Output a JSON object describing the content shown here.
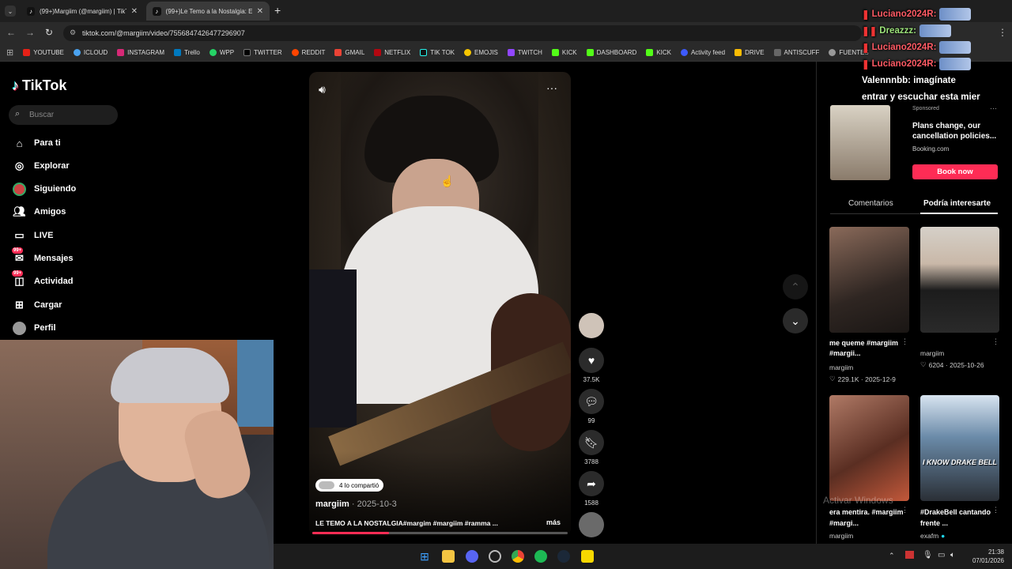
{
  "browser": {
    "tabs": [
      {
        "label": "(99+)Margiim (@margiim) | TikTok",
        "active": false
      },
      {
        "label": "(99+)Le Temo a la Nostalgia: Ex",
        "active": true
      }
    ],
    "new_tab": "+",
    "url": "tiktok.com/@margiim/video/7556847426477296907",
    "bookmarks": [
      "YOUTUBE",
      "ICLOUD",
      "INSTAGRAM",
      "Trello",
      "WPP",
      "TWITTER",
      "REDDIT",
      "GMAIL",
      "NETFLIX",
      "TIK TOK",
      "EMOJIS",
      "TWITCH",
      "KICK",
      "DASHBOARD",
      "KICK",
      "Activity feed",
      "DRIVE",
      "ANTISCUFF",
      "FUENTES"
    ]
  },
  "tiktok": {
    "logo": "TikTok",
    "search_placeholder": "Buscar",
    "nav": [
      "Para ti",
      "Explorar",
      "Siguiendo",
      "Amigos",
      "LIVE",
      "Mensajes",
      "Actividad",
      "Cargar",
      "Perfil"
    ],
    "badge": "99+"
  },
  "video": {
    "shared": "4 lo compartió",
    "author": "margiim",
    "date": "2025-10-3",
    "caption": "LE TEMO A LA NOSTALGIA#margim #margiim #ramma ...",
    "more": "más",
    "progress": 0.3
  },
  "actions": {
    "likes": "37.5K",
    "comments": "99",
    "saves": "3788",
    "shares": "1588"
  },
  "ad": {
    "sponsored": "Sponsored",
    "headline": "Plans change, our cancellation policies...",
    "advertiser": "Booking.com",
    "cta": "Book now"
  },
  "panel_tabs": [
    "Comentarios",
    "Podría interesarte"
  ],
  "suggestions": [
    {
      "title": "me queme #margiim #margii...",
      "author": "margiim",
      "stats": "229.1K · 2025-12-9"
    },
    {
      "title": "margiim",
      "author": "",
      "stats": "6204 · 2025-10-26"
    },
    {
      "title": "era mentira. #margiim #margi...",
      "author": "margiim",
      "stats": ""
    },
    {
      "title": "#DrakeBell cantando frente ...",
      "author": "exafm",
      "stats": "",
      "thumb_text": "I KNOW DRAKE BELL"
    }
  ],
  "watermark": "Activar Windows",
  "chat": [
    {
      "name": "Luciano2024R:",
      "text": ""
    },
    {
      "name": "Dreazzz:",
      "text": ""
    },
    {
      "name": "Luciano2024R:",
      "text": ""
    },
    {
      "name": "Luciano2024R:",
      "text": ""
    },
    {
      "name": "Valennnbb:",
      "text": "imagínate"
    },
    {
      "name": "",
      "text": "entrar y escuchar esta mier"
    }
  ],
  "clock": {
    "time": "21:38",
    "date": "07/01/2026"
  },
  "colors": {
    "brand_pink": "#fe2c55",
    "brand_cyan": "#25f4ee"
  }
}
